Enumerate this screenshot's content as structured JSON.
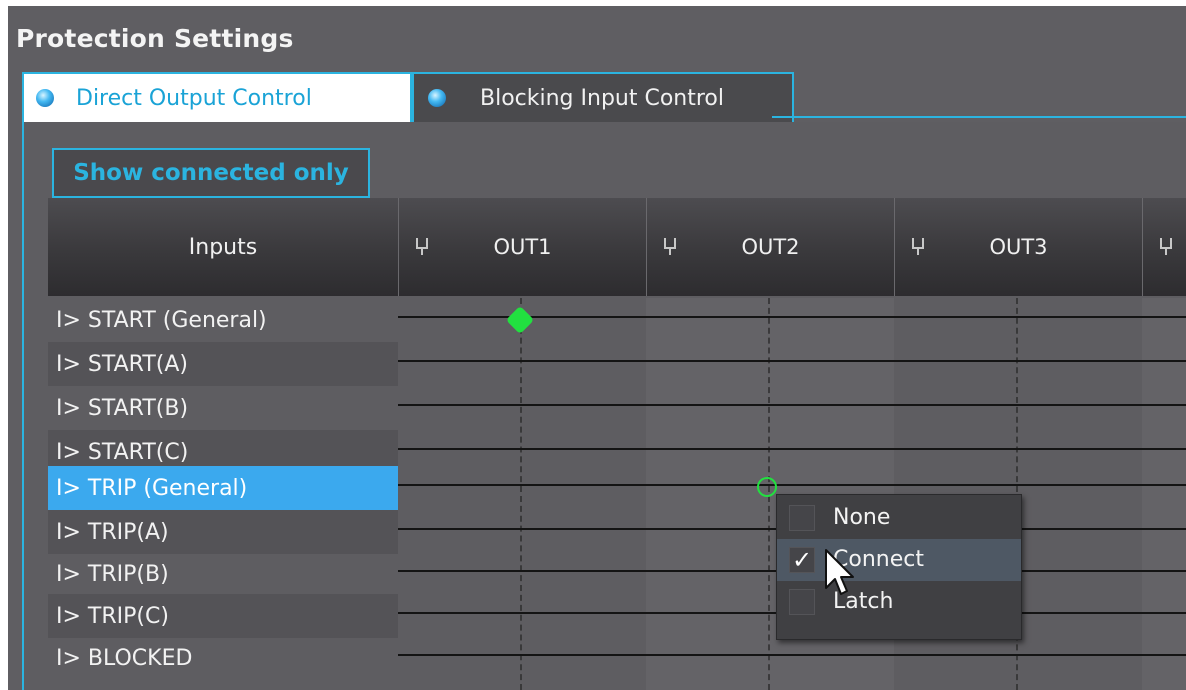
{
  "panel": {
    "title": "Protection Settings"
  },
  "tabs": [
    {
      "label": "Direct Output Control",
      "active": true
    },
    {
      "label": "Blocking Input Control",
      "active": false
    }
  ],
  "toolbar": {
    "show_connected_label": "Show connected only"
  },
  "grid": {
    "inputs_header": "Inputs",
    "outputs": [
      "OUT1",
      "OUT2",
      "OUT3"
    ],
    "rows": [
      {
        "label": "I> START (General)"
      },
      {
        "label": "I> START(A)"
      },
      {
        "label": "I> START(B)"
      },
      {
        "label": "I> START(C)"
      },
      {
        "label": "I> TRIP (General)",
        "selected": true
      },
      {
        "label": "I> TRIP(A)"
      },
      {
        "label": "I> TRIP(B)"
      },
      {
        "label": "I> TRIP(C)"
      },
      {
        "label": "I> BLOCKED"
      }
    ],
    "connections": [
      {
        "row": "I> START (General)",
        "output": "OUT1",
        "mode": "Connect"
      }
    ]
  },
  "context_menu": {
    "items": [
      {
        "label": "None",
        "checked": false
      },
      {
        "label": "Connect",
        "checked": true,
        "hover": true
      },
      {
        "label": "Latch",
        "checked": false
      }
    ],
    "check_glyph": "✓"
  },
  "colors": {
    "accent": "#2bb4e0",
    "selected_row": "#3ba9ee",
    "connection_marker": "#22e040",
    "panel_bg": "#5f5e62"
  }
}
